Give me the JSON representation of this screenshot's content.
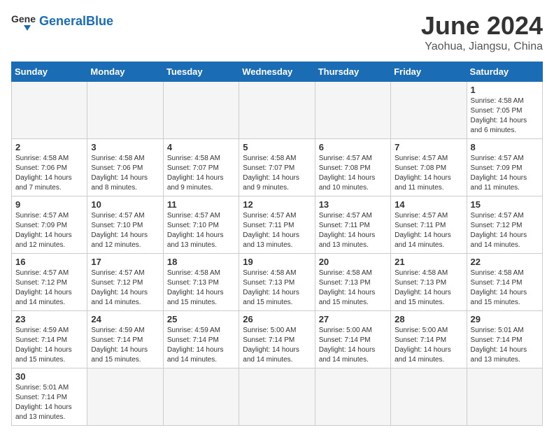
{
  "header": {
    "logo_general": "General",
    "logo_blue": "Blue",
    "month_title": "June 2024",
    "location": "Yaohua, Jiangsu, China"
  },
  "weekdays": [
    "Sunday",
    "Monday",
    "Tuesday",
    "Wednesday",
    "Thursday",
    "Friday",
    "Saturday"
  ],
  "days": [
    {
      "date": 1,
      "sunrise": "4:58 AM",
      "sunset": "7:05 PM",
      "daylight": "14 hours and 6 minutes."
    },
    {
      "date": 2,
      "sunrise": "4:58 AM",
      "sunset": "7:06 PM",
      "daylight": "14 hours and 7 minutes."
    },
    {
      "date": 3,
      "sunrise": "4:58 AM",
      "sunset": "7:06 PM",
      "daylight": "14 hours and 8 minutes."
    },
    {
      "date": 4,
      "sunrise": "4:58 AM",
      "sunset": "7:07 PM",
      "daylight": "14 hours and 9 minutes."
    },
    {
      "date": 5,
      "sunrise": "4:58 AM",
      "sunset": "7:07 PM",
      "daylight": "14 hours and 9 minutes."
    },
    {
      "date": 6,
      "sunrise": "4:57 AM",
      "sunset": "7:08 PM",
      "daylight": "14 hours and 10 minutes."
    },
    {
      "date": 7,
      "sunrise": "4:57 AM",
      "sunset": "7:08 PM",
      "daylight": "14 hours and 11 minutes."
    },
    {
      "date": 8,
      "sunrise": "4:57 AM",
      "sunset": "7:09 PM",
      "daylight": "14 hours and 11 minutes."
    },
    {
      "date": 9,
      "sunrise": "4:57 AM",
      "sunset": "7:09 PM",
      "daylight": "14 hours and 12 minutes."
    },
    {
      "date": 10,
      "sunrise": "4:57 AM",
      "sunset": "7:10 PM",
      "daylight": "14 hours and 12 minutes."
    },
    {
      "date": 11,
      "sunrise": "4:57 AM",
      "sunset": "7:10 PM",
      "daylight": "14 hours and 13 minutes."
    },
    {
      "date": 12,
      "sunrise": "4:57 AM",
      "sunset": "7:11 PM",
      "daylight": "14 hours and 13 minutes."
    },
    {
      "date": 13,
      "sunrise": "4:57 AM",
      "sunset": "7:11 PM",
      "daylight": "14 hours and 13 minutes."
    },
    {
      "date": 14,
      "sunrise": "4:57 AM",
      "sunset": "7:11 PM",
      "daylight": "14 hours and 14 minutes."
    },
    {
      "date": 15,
      "sunrise": "4:57 AM",
      "sunset": "7:12 PM",
      "daylight": "14 hours and 14 minutes."
    },
    {
      "date": 16,
      "sunrise": "4:57 AM",
      "sunset": "7:12 PM",
      "daylight": "14 hours and 14 minutes."
    },
    {
      "date": 17,
      "sunrise": "4:57 AM",
      "sunset": "7:12 PM",
      "daylight": "14 hours and 14 minutes."
    },
    {
      "date": 18,
      "sunrise": "4:58 AM",
      "sunset": "7:13 PM",
      "daylight": "14 hours and 15 minutes."
    },
    {
      "date": 19,
      "sunrise": "4:58 AM",
      "sunset": "7:13 PM",
      "daylight": "14 hours and 15 minutes."
    },
    {
      "date": 20,
      "sunrise": "4:58 AM",
      "sunset": "7:13 PM",
      "daylight": "14 hours and 15 minutes."
    },
    {
      "date": 21,
      "sunrise": "4:58 AM",
      "sunset": "7:13 PM",
      "daylight": "14 hours and 15 minutes."
    },
    {
      "date": 22,
      "sunrise": "4:58 AM",
      "sunset": "7:14 PM",
      "daylight": "14 hours and 15 minutes."
    },
    {
      "date": 23,
      "sunrise": "4:59 AM",
      "sunset": "7:14 PM",
      "daylight": "14 hours and 15 minutes."
    },
    {
      "date": 24,
      "sunrise": "4:59 AM",
      "sunset": "7:14 PM",
      "daylight": "14 hours and 15 minutes."
    },
    {
      "date": 25,
      "sunrise": "4:59 AM",
      "sunset": "7:14 PM",
      "daylight": "14 hours and 14 minutes."
    },
    {
      "date": 26,
      "sunrise": "5:00 AM",
      "sunset": "7:14 PM",
      "daylight": "14 hours and 14 minutes."
    },
    {
      "date": 27,
      "sunrise": "5:00 AM",
      "sunset": "7:14 PM",
      "daylight": "14 hours and 14 minutes."
    },
    {
      "date": 28,
      "sunrise": "5:00 AM",
      "sunset": "7:14 PM",
      "daylight": "14 hours and 14 minutes."
    },
    {
      "date": 29,
      "sunrise": "5:01 AM",
      "sunset": "7:14 PM",
      "daylight": "14 hours and 13 minutes."
    },
    {
      "date": 30,
      "sunrise": "5:01 AM",
      "sunset": "7:14 PM",
      "daylight": "14 hours and 13 minutes."
    }
  ]
}
